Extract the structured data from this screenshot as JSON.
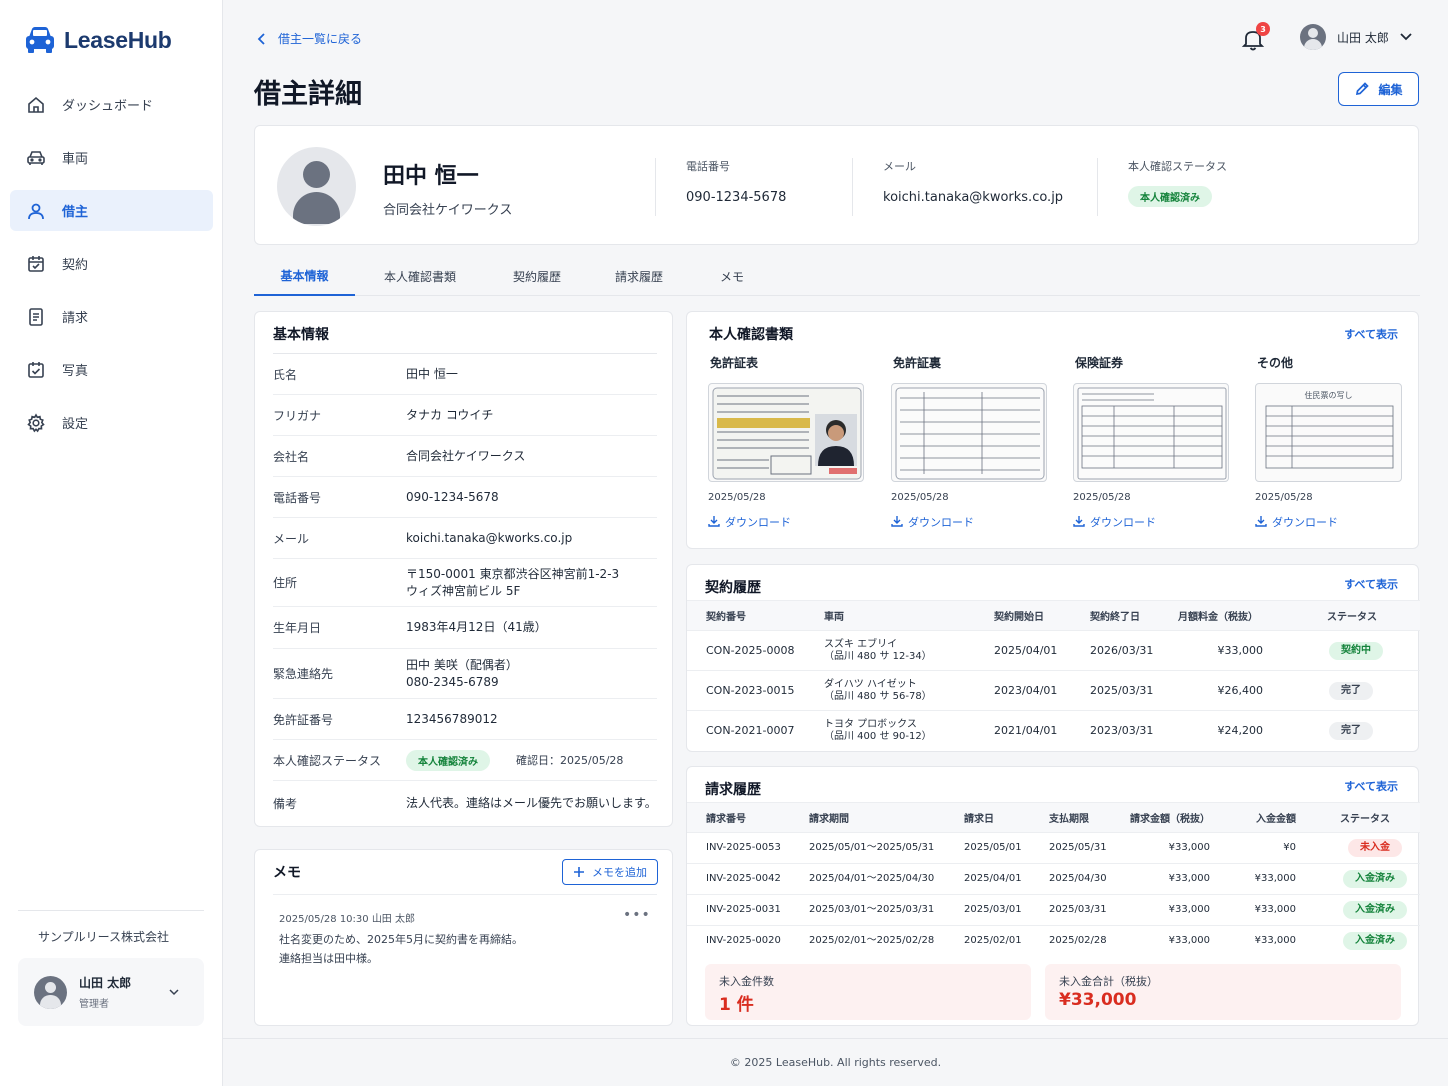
{
  "app": {
    "name": "LeaseHub"
  },
  "sidebar": {
    "items": [
      {
        "label": "ダッシュボード",
        "icon": "home-icon"
      },
      {
        "label": "車両",
        "icon": "car-icon"
      },
      {
        "label": "借主",
        "icon": "user-icon",
        "active": true
      },
      {
        "label": "契約",
        "icon": "calendar-icon"
      },
      {
        "label": "請求",
        "icon": "invoice-icon"
      },
      {
        "label": "写真",
        "icon": "photo-check-icon"
      },
      {
        "label": "設定",
        "icon": "gear-icon"
      }
    ],
    "company": "サンプルリース株式会社",
    "user": {
      "name": "山田 太郎",
      "role": "管理者"
    }
  },
  "header": {
    "back_label": "借主一覧に戻る",
    "title": "借主詳細",
    "notification_count": "3",
    "user_name": "山田 太郎",
    "edit_label": "編集"
  },
  "profile": {
    "name": "田中 恒一",
    "company": "合同会社ケイワークス",
    "phone_label": "電話番号",
    "phone": "090-1234-5678",
    "email_label": "メール",
    "email": "koichi.tanaka@kworks.co.jp",
    "status_label": "本人確認ステータス",
    "status": "本人確認済み"
  },
  "tabs": [
    "基本情報",
    "本人確認書類",
    "契約履歴",
    "請求履歴",
    "メモ"
  ],
  "basic": {
    "title": "基本情報",
    "rows": [
      {
        "k": "氏名",
        "v": "田中 恒一"
      },
      {
        "k": "フリガナ",
        "v": "タナカ コウイチ"
      },
      {
        "k": "会社名",
        "v": "合同会社ケイワークス"
      },
      {
        "k": "電話番号",
        "v": "090-1234-5678"
      },
      {
        "k": "メール",
        "v": "koichi.tanaka@kworks.co.jp"
      },
      {
        "k": "住所",
        "v": "〒150-0001 東京都渋谷区神宮前1-2-3",
        "v2": "ウィズ神宮前ビル 5F"
      },
      {
        "k": "生年月日",
        "v": "1983年4月12日（41歳）"
      },
      {
        "k": "緊急連絡先",
        "v": "田中 美咲（配偶者）",
        "v2": "080-2345-6789"
      },
      {
        "k": "免許証番号",
        "v": "123456789012"
      },
      {
        "k": "本人確認ステータス",
        "v": "本人確認済み",
        "v2": "確認日：2025/05/28"
      },
      {
        "k": "備考",
        "v": "法人代表。連絡はメール優先でお願いします。"
      }
    ]
  },
  "memo": {
    "title": "メモ",
    "add_label": "メモを追加",
    "entries": [
      {
        "meta": "2025/05/28  10:30     山田 太郎",
        "body": "社名変更のため、2025年5月に契約書を再締結。\n連絡担当は田中様。"
      }
    ]
  },
  "documents": {
    "title": "本人確認書類",
    "see_all": "すべて表示",
    "items": [
      {
        "title": "免許証表",
        "date": "2025/05/28",
        "download": "ダウンロード"
      },
      {
        "title": "免許証裏",
        "date": "2025/05/28",
        "download": "ダウンロード"
      },
      {
        "title": "保険証券",
        "date": "2025/05/28",
        "download": "ダウンロード"
      },
      {
        "title": "その他",
        "date": "2025/05/28",
        "download": "ダウンロード",
        "thumb_caption": "住民票の写し"
      }
    ]
  },
  "contracts": {
    "title": "契約履歴",
    "see_all": "すべて表示",
    "columns": [
      "契約番号",
      "車両",
      "契約開始日",
      "契約終了日",
      "月額料金（税抜）",
      "ステータス"
    ],
    "rows": [
      {
        "id": "CON-2025-0008",
        "car": "スズキ エブリイ",
        "plate": "（品川 480 サ 12-34）",
        "start": "2025/04/01",
        "end": "2026/03/31",
        "fee": "¥33,000",
        "status": "契約中",
        "tone": "green"
      },
      {
        "id": "CON-2023-0015",
        "car": "ダイハツ ハイゼット",
        "plate": "（品川 480 サ 56-78）",
        "start": "2023/04/01",
        "end": "2025/03/31",
        "fee": "¥26,400",
        "status": "完了",
        "tone": "gray"
      },
      {
        "id": "CON-2021-0007",
        "car": "トヨタ プロボックス",
        "plate": "（品川 400 せ 90-12）",
        "start": "2021/04/01",
        "end": "2023/03/31",
        "fee": "¥24,200",
        "status": "完了",
        "tone": "gray"
      }
    ]
  },
  "bills": {
    "title": "請求履歴",
    "see_all": "すべて表示",
    "columns": [
      "請求番号",
      "請求期間",
      "請求日",
      "支払期限",
      "請求金額（税抜）",
      "入金金額",
      "ステータス"
    ],
    "rows": [
      {
        "id": "INV-2025-0053",
        "period": "2025/05/01～2025/05/31",
        "date": "2025/05/01",
        "due": "2025/05/31",
        "amount": "¥33,000",
        "paid": "¥0",
        "status": "未入金",
        "tone": "red"
      },
      {
        "id": "INV-2025-0042",
        "period": "2025/04/01～2025/04/30",
        "date": "2025/04/01",
        "due": "2025/04/30",
        "amount": "¥33,000",
        "paid": "¥33,000",
        "status": "入金済み",
        "tone": "green"
      },
      {
        "id": "INV-2025-0031",
        "period": "2025/03/01～2025/03/31",
        "date": "2025/03/01",
        "due": "2025/03/31",
        "amount": "¥33,000",
        "paid": "¥33,000",
        "status": "入金済み",
        "tone": "green"
      },
      {
        "id": "INV-2025-0020",
        "period": "2025/02/01～2025/02/28",
        "date": "2025/02/01",
        "due": "2025/02/28",
        "amount": "¥33,000",
        "paid": "¥33,000",
        "status": "入金済み",
        "tone": "green"
      }
    ],
    "unpaid_count_label": "未入金件数",
    "unpaid_count": "1 件",
    "unpaid_total_label": "未入金合計（税抜）",
    "unpaid_total": "¥33,000"
  },
  "footer": "© 2025 LeaseHub. All rights reserved.",
  "colors": {
    "accent": "#1e63d6",
    "brand": "#1c3a6e",
    "success": "#14833b",
    "danger": "#d92d20"
  }
}
